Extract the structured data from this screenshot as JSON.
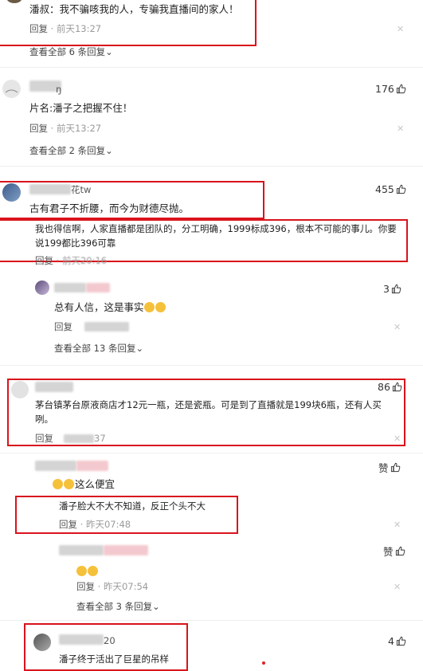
{
  "comments": [
    {
      "text": "潘叔：我不骗咳我的人，专骗我直播间的家人！",
      "reply_label": "回复",
      "time": "前天13:27",
      "view_more": "查看全部 6 条回复"
    },
    {
      "user_suffix": "ŋ",
      "likes": "176",
      "text": "片名:潘子之把握不住！",
      "reply_label": "回复",
      "time": "前天13:27",
      "view_more": "查看全部 2 条回复"
    },
    {
      "user_suffix": "花tw",
      "likes": "455",
      "text": "古有君子不折腰，而今为财德尽抛。",
      "sub_reply": {
        "text_line1": "我也得信啊，人家直播都是团队的，分工明确，1999标成396，根本不可能的事儿。你要",
        "text_line2": "说199都比396可靠",
        "reply_label": "回复",
        "time": "前天20:16"
      },
      "nested_reply": {
        "likes": "3",
        "text": "总有人信，这是事实",
        "reply_label": "回复"
      },
      "view_more": "查看全部 13 条回复"
    },
    {
      "likes": "86",
      "text_line1": "茅台镇茅台原液商店才12元一瓶，还是瓷瓶。可是到了直播就是199块6瓶，还有人买",
      "text_line2": "咧。",
      "reply_label": "回复",
      "time_suffix": "37"
    },
    {
      "likes": "赞",
      "text": "这么便宜",
      "sub_reply": {
        "text": "潘子脸大不大不知道，反正个头不大",
        "reply_label": "回复",
        "time": "昨天07:48"
      },
      "nested_reply": {
        "likes": "赞",
        "reply_label": "回复",
        "time": "昨天07:54"
      },
      "view_more": "查看全部 3 条回复"
    },
    {
      "user_suffix": "20",
      "likes": "4",
      "text": "潘子终于活出了巨星的吊样"
    }
  ],
  "icons": {
    "like": "thumbs-up-icon",
    "close": "close-icon",
    "chevron": "chevron-down-icon"
  },
  "colors": {
    "highlight_border": "#d9141c"
  }
}
